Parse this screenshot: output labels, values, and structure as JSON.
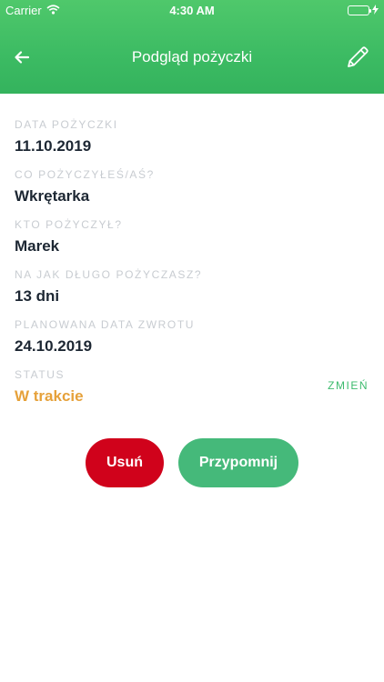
{
  "status_bar": {
    "carrier": "Carrier",
    "time": "4:30 AM"
  },
  "nav": {
    "title": "Podgląd pożyczki"
  },
  "fields": {
    "loan_date": {
      "label": "DATA POŻYCZKI",
      "value": "11.10.2019"
    },
    "item": {
      "label": "CO POŻYCZYŁEŚ/AŚ?",
      "value": "Wkrętarka"
    },
    "borrower": {
      "label": "KTO POŻYCZYŁ?",
      "value": "Marek"
    },
    "duration": {
      "label": "NA JAK DŁUGO POŻYCZASZ?",
      "value": "13 dni"
    },
    "return_date": {
      "label": "PLANOWANA DATA ZWROTU",
      "value": "24.10.2019"
    },
    "status": {
      "label": "STATUS",
      "value": "W trakcie",
      "change_label": "ZMIEŃ"
    }
  },
  "actions": {
    "delete_label": "Usuń",
    "remind_label": "Przypomnij"
  },
  "colors": {
    "header_green": "#3cbb63",
    "status_orange": "#e6a13a",
    "delete_red": "#d0021b",
    "remind_green": "#45b97a"
  },
  "icons": {
    "back": "arrow-left-icon",
    "edit": "pencil-icon",
    "wifi": "wifi-icon",
    "battery": "battery-icon"
  }
}
